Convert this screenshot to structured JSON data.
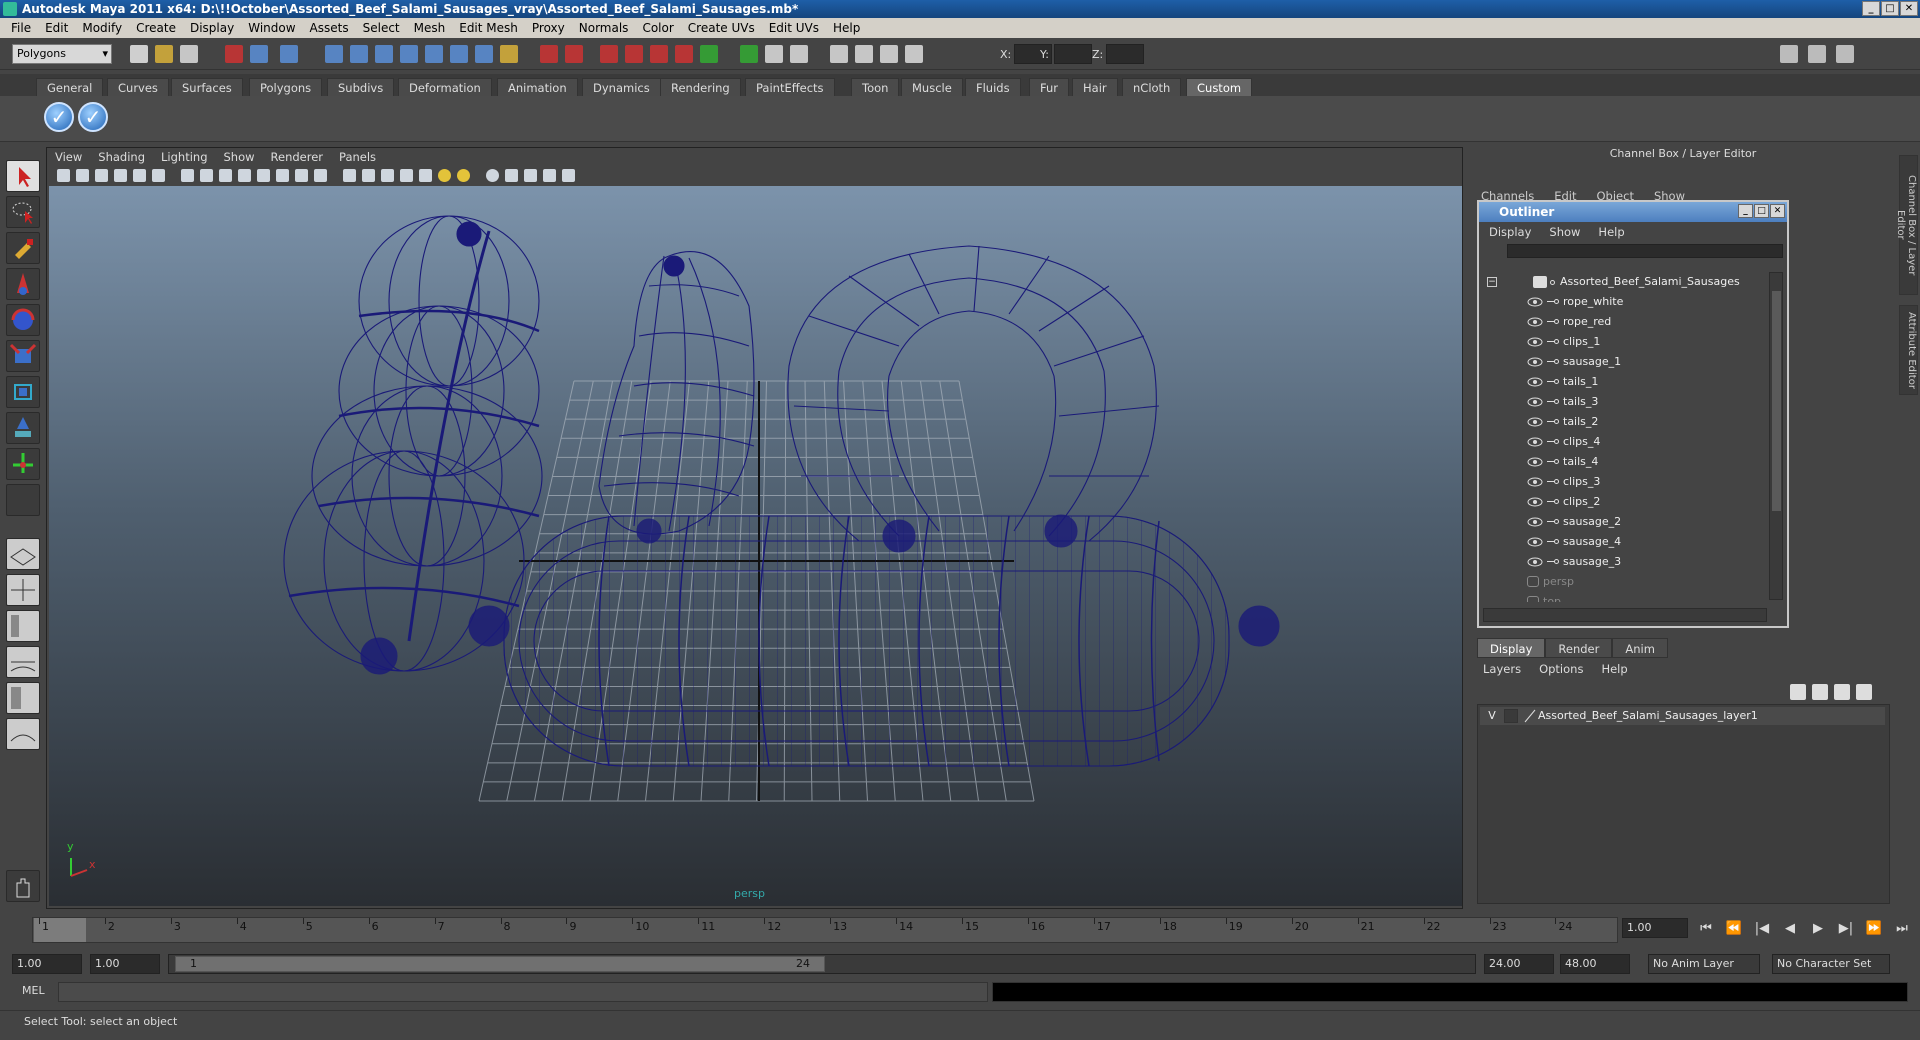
{
  "window": {
    "title": "Autodesk Maya 2011 x64: D:\\!!October\\Assorted_Beef_Salami_Sausages_vray\\Assorted_Beef_Salami_Sausages.mb*",
    "controls": [
      "_",
      "□",
      "✕"
    ]
  },
  "menubar": [
    "File",
    "Edit",
    "Modify",
    "Create",
    "Display",
    "Window",
    "Assets",
    "Select",
    "Mesh",
    "Edit Mesh",
    "Proxy",
    "Normals",
    "Color",
    "Create UVs",
    "Edit UVs",
    "Help"
  ],
  "toolbar": {
    "mode": "Polygons",
    "x_label": "X:",
    "y_label": "Y:",
    "z_label": "Z:"
  },
  "shelf_tabs": [
    "General",
    "Curves",
    "Surfaces",
    "Polygons",
    "Subdivs",
    "Deformation",
    "Animation",
    "Dynamics",
    "Rendering",
    "PaintEffects",
    "Toon",
    "Muscle",
    "Fluids",
    "Fur",
    "Hair",
    "nCloth",
    "Custom"
  ],
  "shelf_active": "Custom",
  "viewport": {
    "menu": [
      "View",
      "Shading",
      "Lighting",
      "Show",
      "Renderer",
      "Panels"
    ],
    "camera": "persp",
    "axis_y": "y",
    "axis_x": "x",
    "wire_color": "#1a1a78"
  },
  "channel_box": {
    "title": "Channel Box / Layer Editor",
    "menu": [
      "Channels",
      "Edit",
      "Object",
      "Show"
    ]
  },
  "outliner": {
    "title": "Outliner",
    "menu": [
      "Display",
      "Show",
      "Help"
    ],
    "root": "Assorted_Beef_Salami_Sausages",
    "children": [
      "rope_white",
      "rope_red",
      "clips_1",
      "sausage_1",
      "tails_1",
      "tails_3",
      "tails_2",
      "clips_4",
      "tails_4",
      "clips_3",
      "clips_2",
      "sausage_2",
      "sausage_4",
      "sausage_3"
    ],
    "cameras": [
      "persp",
      "top"
    ]
  },
  "layer_editor": {
    "tabs": [
      "Display",
      "Render",
      "Anim"
    ],
    "menu": [
      "Layers",
      "Options",
      "Help"
    ],
    "layer_visible": "V",
    "layer_name": "Assorted_Beef_Salami_Sausages_layer1"
  },
  "side_tabs": [
    "Channel Box / Layer Editor",
    "Attribute Editor"
  ],
  "timeline": {
    "ticks": [
      "1",
      "2",
      "3",
      "4",
      "5",
      "6",
      "7",
      "8",
      "9",
      "10",
      "11",
      "12",
      "13",
      "14",
      "15",
      "16",
      "17",
      "18",
      "19",
      "20",
      "21",
      "22",
      "23",
      "24"
    ],
    "current_frame": "1.00",
    "playback": [
      "⏮",
      "⏪",
      "|◀",
      "◀",
      "▶",
      "▶|",
      "⏩",
      "⏭"
    ]
  },
  "range": {
    "start": "1.00",
    "playback_start": "1.00",
    "slider_start": "1",
    "slider_end": "24",
    "playback_end": "24.00",
    "end": "48.00",
    "anim_layer": "No Anim Layer",
    "character_set": "No Character Set"
  },
  "mel": {
    "label": "MEL"
  },
  "help_line": "Select Tool: select an object"
}
